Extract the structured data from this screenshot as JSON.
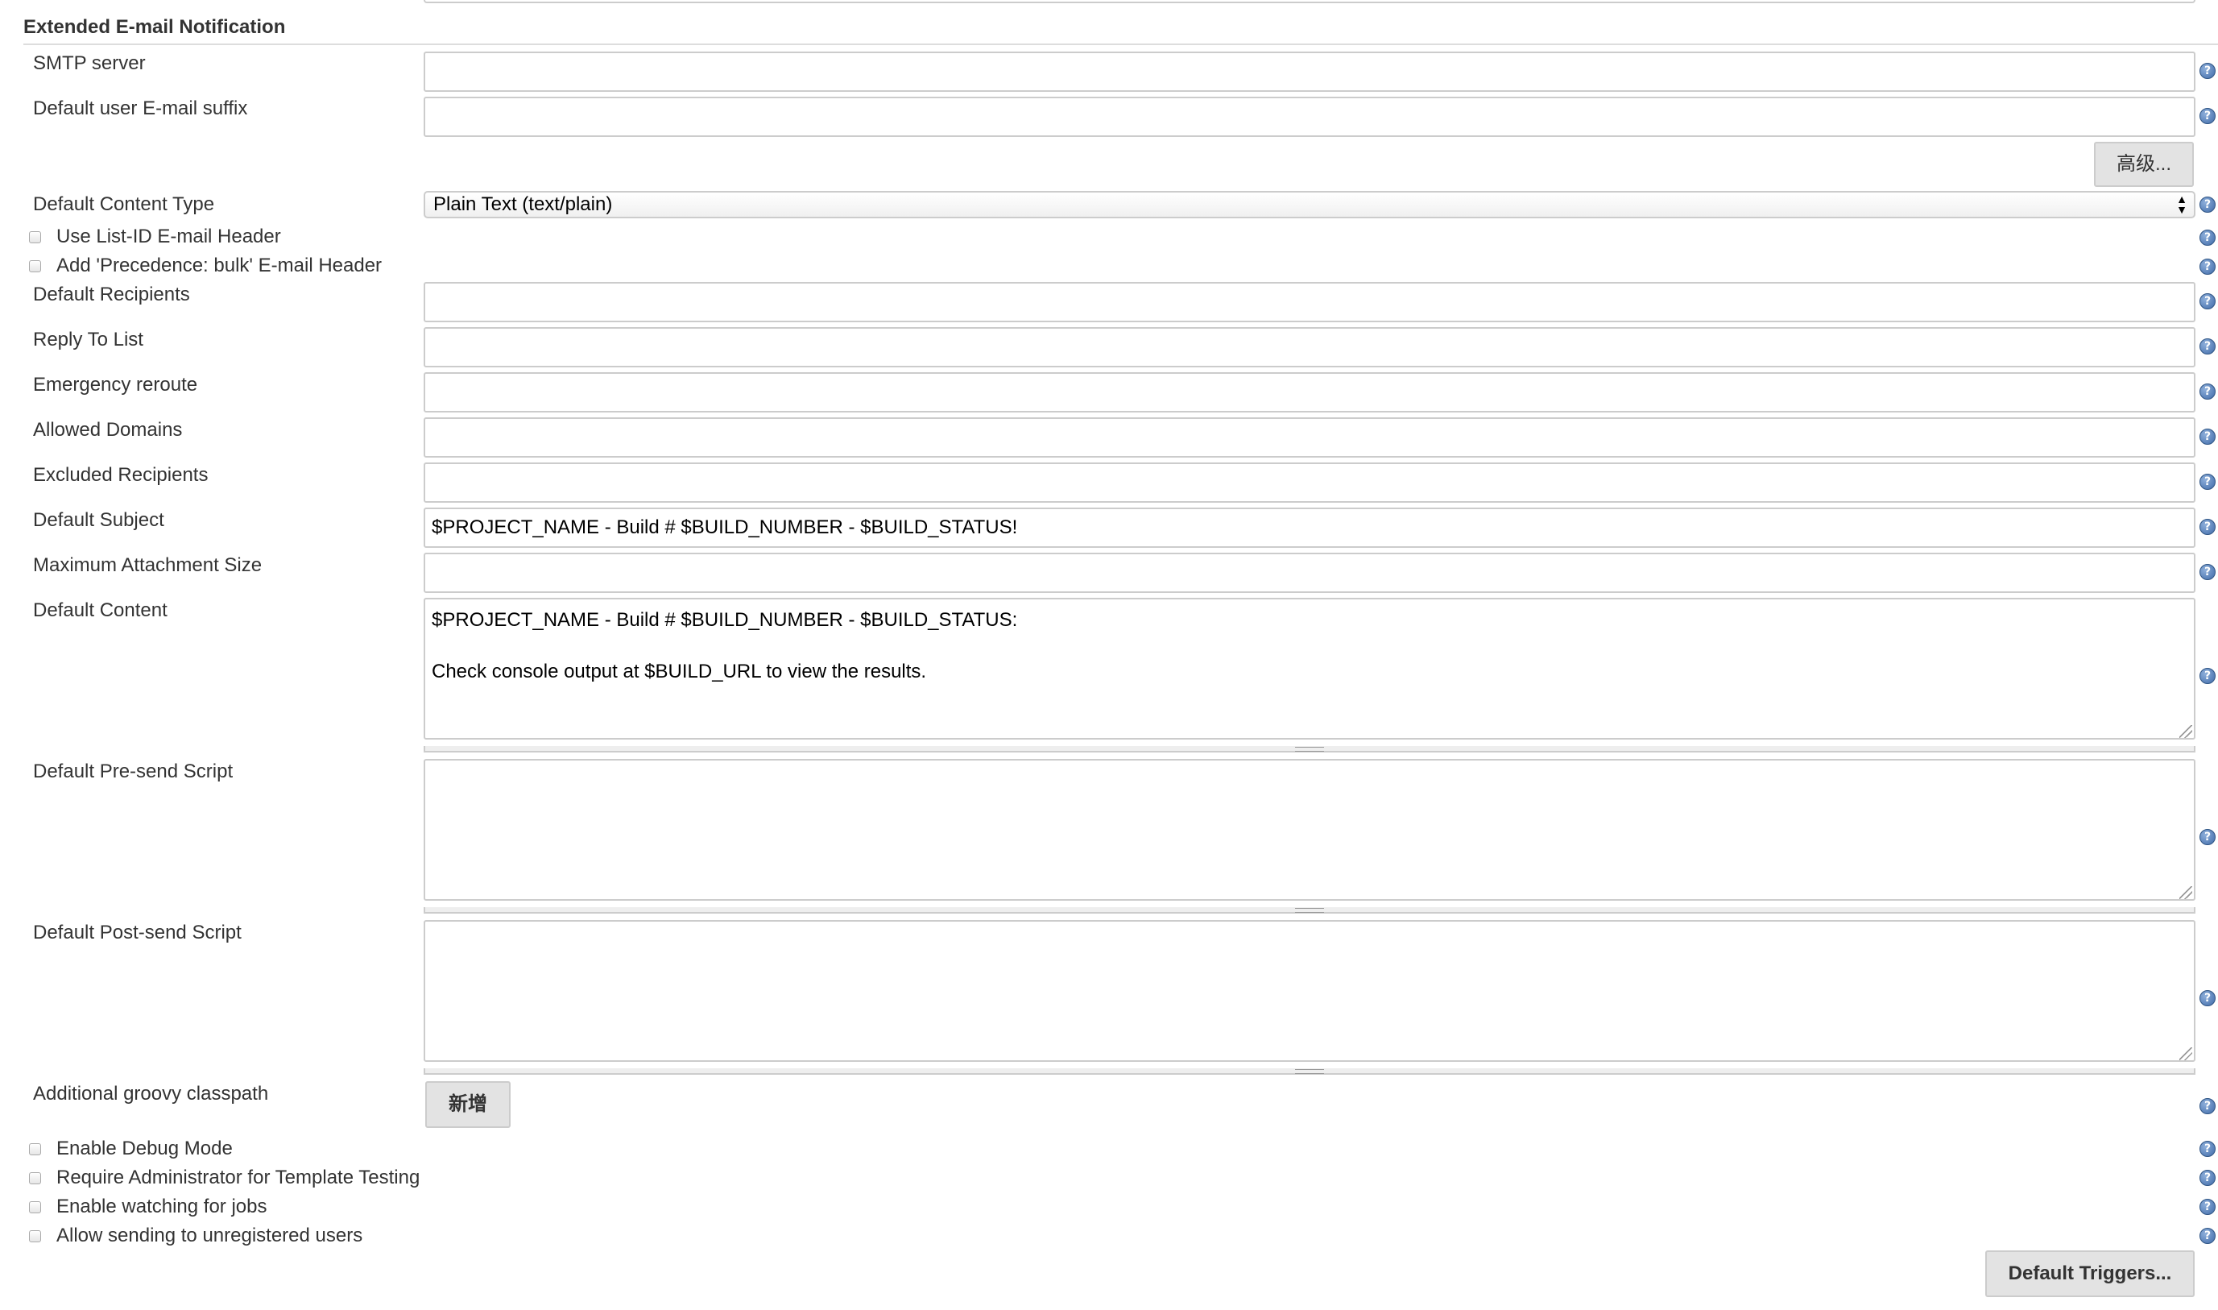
{
  "section": {
    "title": "Extended E-mail Notification"
  },
  "fields": {
    "smtp_server": {
      "label": "SMTP server",
      "value": ""
    },
    "default_suffix": {
      "label": "Default user E-mail suffix",
      "value": ""
    },
    "advanced_button": "高级...",
    "content_type": {
      "label": "Default Content Type",
      "selected": "Plain Text (text/plain)"
    },
    "use_list_id": {
      "label": "Use List-ID E-mail Header",
      "checked": false
    },
    "precedence_bulk": {
      "label": "Add 'Precedence: bulk' E-mail Header",
      "checked": false
    },
    "default_recipients": {
      "label": "Default Recipients",
      "value": ""
    },
    "reply_to_list": {
      "label": "Reply To List",
      "value": ""
    },
    "emergency_reroute": {
      "label": "Emergency reroute",
      "value": ""
    },
    "allowed_domains": {
      "label": "Allowed Domains",
      "value": ""
    },
    "excluded_recipients": {
      "label": "Excluded Recipients",
      "value": ""
    },
    "default_subject": {
      "label": "Default Subject",
      "value": "$PROJECT_NAME - Build # $BUILD_NUMBER - $BUILD_STATUS!"
    },
    "max_attachment_size": {
      "label": "Maximum Attachment Size",
      "value": ""
    },
    "default_content": {
      "label": "Default Content",
      "value": "$PROJECT_NAME - Build # $BUILD_NUMBER - $BUILD_STATUS:\n\nCheck console output at $BUILD_URL to view the results."
    },
    "presend_script": {
      "label": "Default Pre-send Script",
      "value": ""
    },
    "postsend_script": {
      "label": "Default Post-send Script",
      "value": ""
    },
    "groovy_classpath": {
      "label": "Additional groovy classpath",
      "add_button": "新增"
    },
    "debug_mode": {
      "label": "Enable Debug Mode",
      "checked": false
    },
    "admin_template_testing": {
      "label": "Require Administrator for Template Testing",
      "checked": false
    },
    "watching_jobs": {
      "label": "Enable watching for jobs",
      "checked": false
    },
    "unregistered_users": {
      "label": "Allow sending to unregistered users",
      "checked": false
    },
    "default_triggers_button": "Default Triggers..."
  },
  "icons": {
    "help": "help-icon",
    "help_glyph": "?",
    "select_arrows": "▲▼",
    "help_color": "#3f6aa8"
  }
}
